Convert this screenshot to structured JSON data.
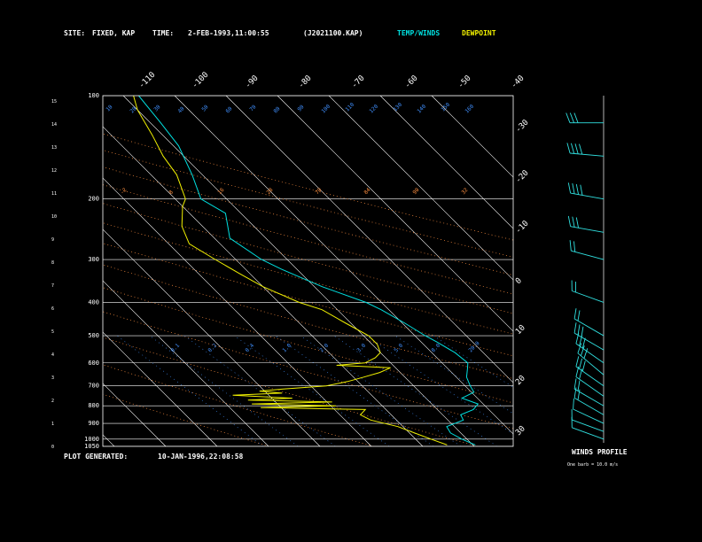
{
  "header": {
    "site_label": "SITE:",
    "site_value": "FIXED, KAP",
    "time_label": "TIME:",
    "time_value": "2-FEB-1993,11:00:55",
    "file_value": "(J2021100.KAP)",
    "legend_temp": "TEMP/WINDS",
    "legend_dew": "DEWPOINT"
  },
  "footer": {
    "generated_label": "PLOT GENERATED:",
    "generated_value": "10-JAN-1996,22:08:58",
    "winds_title": "WINDS PROFILE",
    "barb_note": "One barb = 10.0 m/s"
  },
  "colors": {
    "temp": "#00e0e0",
    "dew": "#f0f000",
    "grid": "#ffffff",
    "dry_adiabat": "#ff9040",
    "mixing_ratio": "#4090ff",
    "barb": "#30e0e0"
  },
  "chart_data": {
    "type": "skew-t",
    "pressure_levels": [
      100,
      200,
      300,
      400,
      500,
      600,
      700,
      800,
      900,
      1000,
      1050
    ],
    "pressure_tick_labels": [
      "100",
      "200",
      "300",
      "400",
      "500",
      "600",
      "700",
      "800",
      "900",
      "1000",
      "1050"
    ],
    "height_ticks": [
      "15",
      "14",
      "13",
      "12",
      "11",
      "10",
      "9",
      "8",
      "7",
      "6",
      "5",
      "4",
      "3",
      "2",
      "1",
      "0"
    ],
    "top_temp_labels": [
      "-110",
      "-100",
      "-90",
      "-80",
      "-70",
      "-60",
      "-50",
      "-40"
    ],
    "right_temp_labels": [
      "-30",
      "-20",
      "-10",
      "0",
      "10",
      "20",
      "30"
    ],
    "dry_adiabat_labels": [
      "-2",
      "8",
      "16",
      "28",
      "70",
      "84",
      "90",
      "32"
    ],
    "mixing_labels": [
      "10",
      "20",
      "30",
      "40",
      "50",
      "60",
      "70",
      "80",
      "90",
      "100",
      "110",
      "120",
      "130",
      "140",
      "150",
      "160",
      "0.1",
      "0.2",
      "0.4",
      "1.0",
      "2.0",
      "3.0",
      "5.0",
      "8.0",
      "20.0"
    ],
    "series": [
      {
        "name": "TEMP",
        "points": [
          [
            1040,
            0.5
          ],
          [
            1000,
            -1
          ],
          [
            960,
            -2
          ],
          [
            920,
            -1.5
          ],
          [
            880,
            3
          ],
          [
            850,
            3.5
          ],
          [
            820,
            7
          ],
          [
            790,
            9
          ],
          [
            760,
            7
          ],
          [
            730,
            10.5
          ],
          [
            700,
            11
          ],
          [
            660,
            12
          ],
          [
            620,
            14
          ],
          [
            600,
            15
          ],
          [
            560,
            14.5
          ],
          [
            520,
            13
          ],
          [
            500,
            12
          ],
          [
            460,
            10.5
          ],
          [
            420,
            8.5
          ],
          [
            400,
            7
          ],
          [
            360,
            1.5
          ],
          [
            320,
            -3
          ],
          [
            300,
            -5
          ],
          [
            260,
            -7
          ],
          [
            220,
            -3
          ],
          [
            200,
            -5
          ],
          [
            170,
            -2
          ],
          [
            140,
            1
          ],
          [
            120,
            2
          ],
          [
            100,
            3
          ]
        ]
      },
      {
        "name": "DEWPOINT",
        "points": [
          [
            1040,
            -5
          ],
          [
            1000,
            -7
          ],
          [
            960,
            -9
          ],
          [
            920,
            -11
          ],
          [
            880,
            -15
          ],
          [
            850,
            -16
          ],
          [
            820,
            -14
          ],
          [
            810,
            -34
          ],
          [
            800,
            -19
          ],
          [
            790,
            -35
          ],
          [
            780,
            -19
          ],
          [
            770,
            -35
          ],
          [
            760,
            -26
          ],
          [
            745,
            -37
          ],
          [
            735,
            -27
          ],
          [
            725,
            -31
          ],
          [
            715,
            -26
          ],
          [
            700,
            -17
          ],
          [
            680,
            -12
          ],
          [
            660,
            -8
          ],
          [
            640,
            -4
          ],
          [
            620,
            -1
          ],
          [
            610,
            -11
          ],
          [
            600,
            -5
          ],
          [
            580,
            -2
          ],
          [
            560,
            0
          ],
          [
            530,
            1
          ],
          [
            500,
            1
          ],
          [
            460,
            -1
          ],
          [
            420,
            -3
          ],
          [
            400,
            -6
          ],
          [
            360,
            -10
          ],
          [
            330,
            -12
          ],
          [
            300,
            -14
          ],
          [
            270,
            -16
          ],
          [
            240,
            -14
          ],
          [
            210,
            -10
          ],
          [
            200,
            -8
          ],
          [
            170,
            -5
          ],
          [
            150,
            -4
          ],
          [
            130,
            -2
          ],
          [
            110,
            0
          ],
          [
            100,
            2
          ]
        ]
      }
    ],
    "winds": [
      {
        "p": 1000,
        "dir": 290,
        "spd": 6
      },
      {
        "p": 950,
        "dir": 290,
        "spd": 11
      },
      {
        "p": 900,
        "dir": 295,
        "spd": 14
      },
      {
        "p": 850,
        "dir": 300,
        "spd": 18
      },
      {
        "p": 800,
        "dir": 300,
        "spd": 20
      },
      {
        "p": 750,
        "dir": 305,
        "spd": 24
      },
      {
        "p": 700,
        "dir": 305,
        "spd": 28
      },
      {
        "p": 650,
        "dir": 310,
        "spd": 30
      },
      {
        "p": 600,
        "dir": 305,
        "spd": 30
      },
      {
        "p": 550,
        "dir": 300,
        "spd": 26
      },
      {
        "p": 500,
        "dir": 300,
        "spd": 22
      },
      {
        "p": 400,
        "dir": 290,
        "spd": 20
      },
      {
        "p": 300,
        "dir": 285,
        "spd": 24
      },
      {
        "p": 250,
        "dir": 280,
        "spd": 30
      },
      {
        "p": 200,
        "dir": 280,
        "spd": 36
      },
      {
        "p": 150,
        "dir": 275,
        "spd": 40
      },
      {
        "p": 120,
        "dir": 270,
        "spd": 34
      }
    ]
  }
}
